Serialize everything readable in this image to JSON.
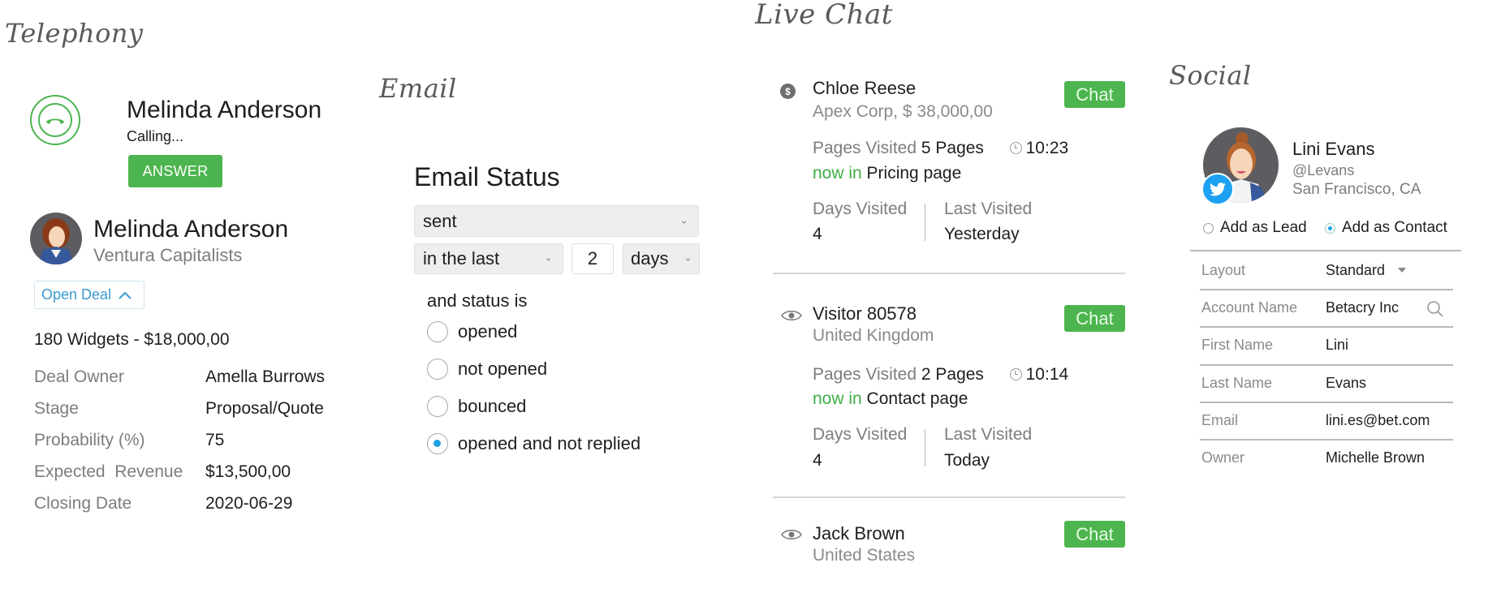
{
  "sections": {
    "telephony": "Telephony",
    "email": "Email",
    "live_chat": "Live Chat",
    "social": "Social"
  },
  "telephony": {
    "caller_name": "Melinda Anderson",
    "call_status": "Calling...",
    "answer_label": "ANSWER",
    "contact": {
      "name": "Melinda Anderson",
      "company": "Ventura Capitalists"
    },
    "open_deal_label": "Open Deal",
    "deal_summary": "180 Widgets - $18,000,00",
    "deal_fields": [
      {
        "label": "Deal Owner",
        "value": "Amella Burrows"
      },
      {
        "label": "Stage",
        "value": "Proposal/Quote"
      },
      {
        "label": "Probability (%)",
        "value": "75"
      },
      {
        "label": "Expected  Revenue",
        "value": "$13,500,00"
      },
      {
        "label": "Closing Date",
        "value": "2020-06-29"
      }
    ]
  },
  "email": {
    "title": "Email Status",
    "status_select": "sent",
    "range_select": "in the last",
    "range_value": "2",
    "unit_select": "days",
    "status_prompt": "and status is",
    "options": [
      {
        "label": "opened",
        "checked": false
      },
      {
        "label": "not opened",
        "checked": false
      },
      {
        "label": "bounced",
        "checked": false
      },
      {
        "label": "opened and not replied",
        "checked": true
      }
    ]
  },
  "live_chat": {
    "chat_label": "Chat",
    "visitors": [
      {
        "icon": "dollar-icon",
        "name": "Chloe Reese",
        "subtitle": "Apex Corp, $ 38,000,00",
        "pages_label": "Pages Visited",
        "pages_value": "5 Pages",
        "time": "10:23",
        "now_in_label": "now in",
        "now_in_value": "Pricing page",
        "days_label": "Days Visited",
        "days_value": "4",
        "last_label": "Last Visited",
        "last_value": "Yesterday"
      },
      {
        "icon": "eye-icon",
        "name": "Visitor 80578",
        "subtitle": "United Kingdom",
        "pages_label": "Pages Visited",
        "pages_value": "2 Pages",
        "time": "10:14",
        "now_in_label": "now in",
        "now_in_value": "Contact page",
        "days_label": "Days Visited",
        "days_value": "4",
        "last_label": "Last Visited",
        "last_value": "Today"
      },
      {
        "icon": "eye-icon",
        "name": "Jack Brown",
        "subtitle": "United States"
      }
    ]
  },
  "social": {
    "profile": {
      "name": "Lini Evans",
      "handle": "@Levans",
      "location": "San Francisco, CA",
      "network": "twitter"
    },
    "add_as_lead": {
      "label": "Add as Lead",
      "checked": false
    },
    "add_as_contact": {
      "label": "Add as Contact",
      "checked": true
    },
    "fields": [
      {
        "label": "Layout",
        "value": "Standard"
      },
      {
        "label": "Account Name",
        "value": "Betacry Inc"
      },
      {
        "label": "First Name",
        "value": "Lini"
      },
      {
        "label": "Last Name",
        "value": "Evans"
      },
      {
        "label": "Email",
        "value": "lini.es@bet.com"
      },
      {
        "label": "Owner",
        "value": "Michelle Brown"
      }
    ]
  },
  "colors": {
    "green": "#4cb54f",
    "blue": "#1aa1e6",
    "link_blue": "#3a9ad0",
    "twitter_blue": "#1da1f2"
  }
}
